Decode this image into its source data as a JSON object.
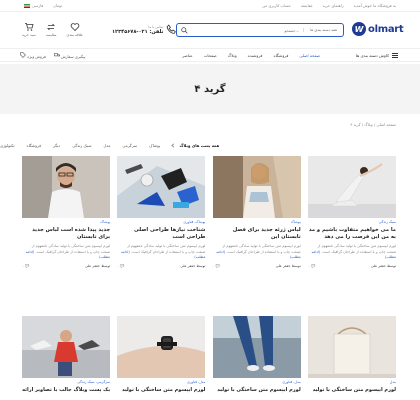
{
  "topbar": {
    "lang": "فارسی",
    "currency": "تومان",
    "links": [
      "حساب کاربری من",
      "مقایسه",
      "راهنمای خرید"
    ],
    "promo": "به فروشگاه ما خوش آمدید"
  },
  "header": {
    "icons": [
      {
        "icon": "cart-icon",
        "label": "سبد خرید"
      },
      {
        "icon": "compare-icon",
        "label": "مقایسه"
      },
      {
        "icon": "heart-icon",
        "label": "علاقه مندی"
      }
    ],
    "phone_label": "تماس با ما",
    "phone_number": "تلفن: ۰۲۱-۱۲۳۴۵۶۷۸",
    "search_placeholder": "جستجو...",
    "search_category": "همه دسته بندی ها",
    "logo_text": "olmart",
    "logo_mark": "W"
  },
  "nav": {
    "left_items": [
      "پیگیری سفارش",
      "فروش ویژه"
    ],
    "menu": [
      "صفحه اصلی",
      "فروشگاه",
      "فروشنده",
      "وبلاگ",
      "صفحات",
      "عناصر"
    ],
    "active_index": 0,
    "categories_label": "کاوش دسته بندی ها"
  },
  "hero": {
    "title": "گرید ۴"
  },
  "breadcrumb": "صفحه اصلی / وبلاگ / گرید ۴",
  "filters": {
    "items": [
      "همه پست های وبلاگ",
      "پوشاک",
      "سرگرمی",
      "مدل",
      "سبک زندگی",
      "دیگر",
      "فروشگاه",
      "تکنولوژی"
    ],
    "active_index": 0
  },
  "posts_row1": [
    {
      "meta": "سبک زندگی",
      "title": "ما می خواهیم متفاوت باشیم و مد به من این فرصت را می دهد",
      "excerpt": "لورم ایپسوم متن ساختگی با تولید سادگی نامفهوم از صنعت چاپ و با استفاده از طراحان گرافیک است.",
      "more": "(ادامه مطلب)",
      "author": "توسط جعفر علی",
      "comments": "۰",
      "img": "yoga"
    },
    {
      "meta": "پوشاک",
      "title": "لباس ژرئه جدید برای فصل تابستان این",
      "excerpt": "لورم ایپسوم متن ساختگی با تولید سادگی نامفهوم از صنعت چاپ و با استفاده از طراحان گرافیک است.",
      "more": "(ادامه مطلب)",
      "author": "توسط جعفر علی",
      "comments": "۰",
      "img": "woman"
    },
    {
      "meta": "پوشاک، فناوری",
      "title": "شناخت نیازها طراحی اصلی طراحی است",
      "excerpt": "لورم ایپسوم متن ساختگی با تولید سادگی نامفهوم از صنعت چاپ و با استفاده از طراحان گرافیک است.",
      "more": "(ادامه مطلب)",
      "author": "توسط جعفر علی",
      "comments": "۰",
      "img": "tools"
    },
    {
      "meta": "پوشاک",
      "title": "جدید پیدا شده است لباس جدید برای تابستان",
      "excerpt": "لورم ایپسوم متن ساختگی با تولید سادگی نامفهوم از صنعت چاپ و با استفاده از طراحان گرافیک است.",
      "more": "(ادامه مطلب)",
      "author": "توسط جعفر علی",
      "comments": "۰",
      "img": "man"
    }
  ],
  "posts_row2": [
    {
      "meta": "مدل",
      "title": "لورم ایپسوم متن ساختگی با تولید",
      "img": "bag"
    },
    {
      "meta": "مدل، فناوری",
      "title": "لورم ایپسوم متن ساختگی با تولید",
      "img": "legs"
    },
    {
      "meta": "مدل، فناوری",
      "title": "لورم ایپسوم متن ساختگی با تولید",
      "img": "watch"
    },
    {
      "meta": "سرگرمی، سبک زندگی",
      "title": "یک پست وبلاگ جالب با تصاویر ارائه",
      "img": "shoes"
    }
  ],
  "colors": {
    "accent": "#2a5dcb",
    "logo": "#1f3a93",
    "hero_bg": "#f4f4f4"
  }
}
